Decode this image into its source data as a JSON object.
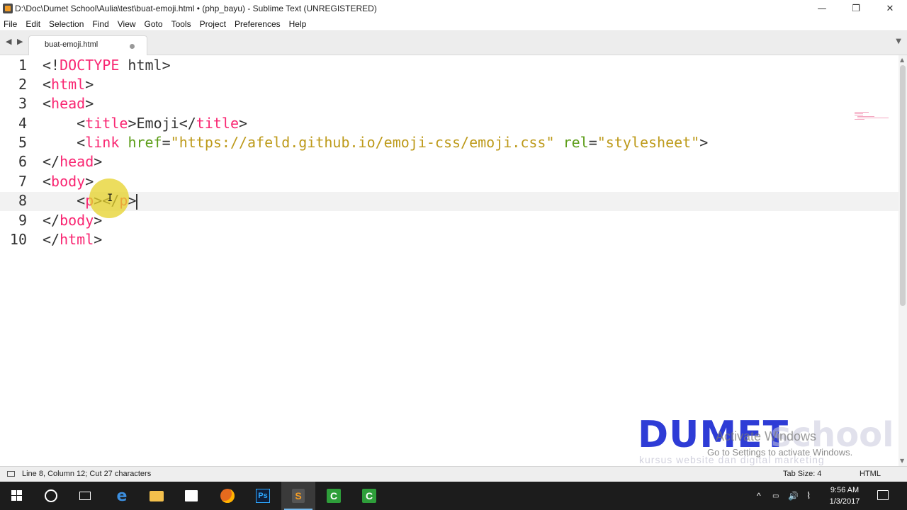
{
  "window": {
    "title": "D:\\Doc\\Dumet School\\Aulia\\test\\buat-emoji.html • (php_bayu) - Sublime Text (UNREGISTERED)",
    "minimize": "—",
    "maximize": "❐",
    "close": "✕"
  },
  "menu": [
    "File",
    "Edit",
    "Selection",
    "Find",
    "View",
    "Goto",
    "Tools",
    "Project",
    "Preferences",
    "Help"
  ],
  "tabs": {
    "back": "◀",
    "forward": "▶",
    "active_tab": "buat-emoji.html",
    "dropdown": "▼"
  },
  "editor": {
    "line_numbers": [
      "1",
      "2",
      "3",
      "4",
      "5",
      "6",
      "7",
      "8",
      "9",
      "10"
    ],
    "lines": [
      [
        {
          "t": "punct",
          "v": "<!"
        },
        {
          "t": "tag",
          "v": "DOCTYPE"
        },
        {
          "t": "txt",
          "v": " html"
        },
        {
          "t": "punct",
          "v": ">"
        }
      ],
      [
        {
          "t": "punct",
          "v": "<"
        },
        {
          "t": "tag",
          "v": "html"
        },
        {
          "t": "punct",
          "v": ">"
        }
      ],
      [
        {
          "t": "punct",
          "v": "<"
        },
        {
          "t": "tag",
          "v": "head"
        },
        {
          "t": "punct",
          "v": ">"
        }
      ],
      [
        {
          "t": "txt",
          "v": "    "
        },
        {
          "t": "punct",
          "v": "<"
        },
        {
          "t": "tag",
          "v": "title"
        },
        {
          "t": "punct",
          "v": ">"
        },
        {
          "t": "txt",
          "v": "Emoji"
        },
        {
          "t": "punct",
          "v": "</"
        },
        {
          "t": "tag",
          "v": "title"
        },
        {
          "t": "punct",
          "v": ">"
        }
      ],
      [
        {
          "t": "txt",
          "v": "    "
        },
        {
          "t": "punct",
          "v": "<"
        },
        {
          "t": "tag",
          "v": "link"
        },
        {
          "t": "txt",
          "v": " "
        },
        {
          "t": "attr",
          "v": "href"
        },
        {
          "t": "punct",
          "v": "="
        },
        {
          "t": "str",
          "v": "\"https://afeld.github.io/emoji-css/emoji.css\""
        },
        {
          "t": "txt",
          "v": " "
        },
        {
          "t": "attr",
          "v": "rel"
        },
        {
          "t": "punct",
          "v": "="
        },
        {
          "t": "str",
          "v": "\"stylesheet\""
        },
        {
          "t": "punct",
          "v": ">"
        }
      ],
      [
        {
          "t": "punct",
          "v": "</"
        },
        {
          "t": "tag",
          "v": "head"
        },
        {
          "t": "punct",
          "v": ">"
        }
      ],
      [
        {
          "t": "punct",
          "v": "<"
        },
        {
          "t": "tag",
          "v": "body"
        },
        {
          "t": "punct",
          "v": ">"
        }
      ],
      [
        {
          "t": "txt",
          "v": "    "
        },
        {
          "t": "punct",
          "v": "<"
        },
        {
          "t": "tag",
          "v": "p"
        },
        {
          "t": "punct",
          "v": "></"
        },
        {
          "t": "tag",
          "v": "p"
        },
        {
          "t": "punct",
          "v": ">"
        }
      ],
      [
        {
          "t": "punct",
          "v": "</"
        },
        {
          "t": "tag",
          "v": "body"
        },
        {
          "t": "punct",
          "v": ">"
        }
      ],
      [
        {
          "t": "punct",
          "v": "</"
        },
        {
          "t": "tag",
          "v": "html"
        },
        {
          "t": "punct",
          "v": ">"
        }
      ]
    ],
    "ibeam": "I"
  },
  "watermark": {
    "brand": "DUMET",
    "brand_suffix": "school",
    "tagline": "kursus website dan digital marketing",
    "activate_title": "Activate Windows",
    "activate_sub": "Go to Settings to activate Windows."
  },
  "status": {
    "position": "Line 8, Column 12; Cut 27 characters",
    "tab_size": "Tab Size: 4",
    "syntax": "HTML"
  },
  "taskbar": {
    "time": "9:56 AM",
    "date": "1/3/2017",
    "ps_label": "Ps",
    "st_label": "S",
    "cam_label": "C",
    "edge_label": "e",
    "tray_chevron": "^",
    "tray_volume": "🔊"
  }
}
